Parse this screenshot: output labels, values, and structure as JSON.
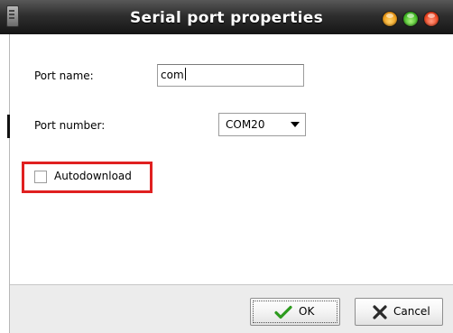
{
  "window": {
    "title": "Serial port properties"
  },
  "form": {
    "port_name_label": "Port name:",
    "port_name_value": "com",
    "port_number_label": "Port number:",
    "port_number_value": "COM20",
    "autodownload_label": "Autodownload",
    "autodownload_checked": false
  },
  "buttons": {
    "ok_label": "OK",
    "cancel_label": "Cancel"
  },
  "colors": {
    "highlight": "#e02020",
    "ok_check": "#2e9b1f",
    "cancel_x": "#2a2a2a"
  },
  "icons": {
    "ok": "checkmark-icon",
    "cancel": "x-icon"
  }
}
